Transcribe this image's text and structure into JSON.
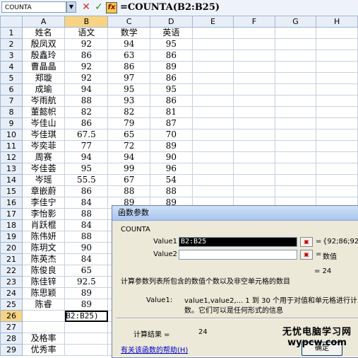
{
  "formula_bar": {
    "name_box": "COUNTA",
    "name_dropdown": "▼",
    "cancel": "✕",
    "enter": "✓",
    "fx": "fx",
    "formula": "=COUNTA(B2:B25)"
  },
  "columns": [
    "A",
    "B",
    "C",
    "D",
    "E",
    "F",
    "G",
    "H"
  ],
  "rows": [
    {
      "n": "1",
      "a": "姓名",
      "b": "语文",
      "c": "数学",
      "d": "英语"
    },
    {
      "n": "2",
      "a": "殷凤双",
      "b": "92",
      "c": "94",
      "d": "95"
    },
    {
      "n": "3",
      "a": "殷鑫玲",
      "b": "86",
      "c": "63",
      "d": "86"
    },
    {
      "n": "4",
      "a": "曹晶晶",
      "b": "92",
      "c": "86",
      "d": "89"
    },
    {
      "n": "5",
      "a": "郑璇",
      "b": "92",
      "c": "97",
      "d": "86"
    },
    {
      "n": "6",
      "a": "成瑜",
      "b": "94",
      "c": "95",
      "d": "95"
    },
    {
      "n": "7",
      "a": "岑雨航",
      "b": "88",
      "c": "93",
      "d": "86"
    },
    {
      "n": "8",
      "a": "董懿帜",
      "b": "82",
      "c": "82",
      "d": "81"
    },
    {
      "n": "9",
      "a": "岑佳山",
      "b": "86",
      "c": "79",
      "d": "87"
    },
    {
      "n": "10",
      "a": "岑佳琪",
      "b": "67.5",
      "c": "65",
      "d": "70"
    },
    {
      "n": "11",
      "a": "岑奕菲",
      "b": "77",
      "c": "72",
      "d": "89"
    },
    {
      "n": "12",
      "a": "周赛",
      "b": "94",
      "c": "94",
      "d": "90"
    },
    {
      "n": "13",
      "a": "岑佳荟",
      "b": "95",
      "c": "99",
      "d": "96"
    },
    {
      "n": "14",
      "a": "岑瑶",
      "b": "55.5",
      "c": "67",
      "d": "54"
    },
    {
      "n": "15",
      "a": "章嵌蔚",
      "b": "86",
      "c": "88",
      "d": "88"
    },
    {
      "n": "16",
      "a": "李佳宁",
      "b": "84",
      "c": "89",
      "d": "89"
    },
    {
      "n": "17",
      "a": "李怡影",
      "b": "88",
      "c": "",
      "d": ""
    },
    {
      "n": "18",
      "a": "肖跃棍",
      "b": "84",
      "c": "",
      "d": ""
    },
    {
      "n": "19",
      "a": "陈伟妍",
      "b": "88",
      "c": "",
      "d": ""
    },
    {
      "n": "20",
      "a": "陈玥文",
      "b": "90",
      "c": "",
      "d": ""
    },
    {
      "n": "21",
      "a": "陈英杰",
      "b": "84",
      "c": "",
      "d": ""
    },
    {
      "n": "22",
      "a": "陈俊良",
      "b": "65",
      "c": "",
      "d": ""
    },
    {
      "n": "23",
      "a": "陈佳锌",
      "b": "92.5",
      "c": "",
      "d": ""
    },
    {
      "n": "24",
      "a": "陈思颖",
      "b": "89",
      "c": "",
      "d": ""
    },
    {
      "n": "25",
      "a": "陈睿",
      "b": "89",
      "c": "",
      "d": ""
    },
    {
      "n": "26",
      "a": "",
      "b": "B2:B25)",
      "c": "",
      "d": ""
    },
    {
      "n": "27",
      "a": "",
      "b": "",
      "c": "",
      "d": ""
    },
    {
      "n": "28",
      "a": "及格率",
      "b": "",
      "c": "",
      "d": ""
    },
    {
      "n": "29",
      "a": "优秀率",
      "b": "",
      "c": "",
      "d": ""
    }
  ],
  "dialog": {
    "title": "函数参数",
    "function_name": "COUNTA",
    "value1_label": "Value1",
    "value1_input": "B2:B25",
    "value1_ref": "▣",
    "value1_eq": "=",
    "value1_preview": "{92;86;92",
    "value2_label": "Value2",
    "value2_input": "",
    "value2_ref": "▣",
    "value2_eq": "=",
    "value2_preview": "数值",
    "result_inline": "= 24",
    "description": "计算参数列表所包含的数值个数以及非空单元格的数目",
    "help_label": "Value1:",
    "help_text": "value1,value2,... 1 到 30 个用于对值和单元格进行计数。它们可以是任何形式的信息",
    "calc_label": "计算结果 =",
    "calc_value": "24",
    "help_link": "有关该函数的帮助(H)",
    "ok_label": "确定"
  },
  "watermark": {
    "line1": "无忧电脑学习网",
    "line2": "wypcw.com"
  }
}
